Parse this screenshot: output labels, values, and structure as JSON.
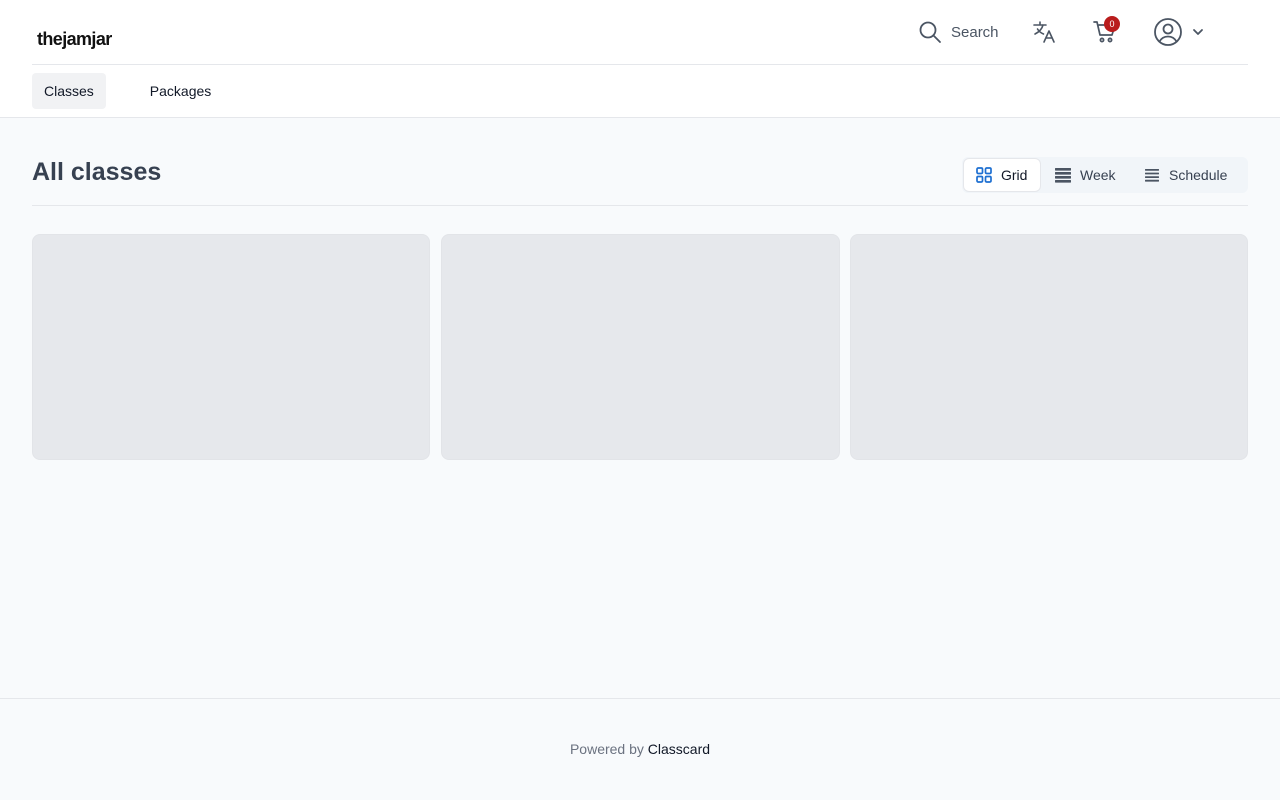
{
  "header": {
    "logo": "thejamjar",
    "search_label": "Search",
    "cart_count": "0",
    "badge_color": "#b91c1c"
  },
  "nav": {
    "tabs": [
      {
        "label": "Classes",
        "active": true
      },
      {
        "label": "Packages",
        "active": false
      }
    ]
  },
  "main": {
    "title": "All classes",
    "views": [
      {
        "label": "Grid",
        "icon": "grid-icon",
        "active": true
      },
      {
        "label": "Week",
        "icon": "week-icon",
        "active": false
      },
      {
        "label": "Schedule",
        "icon": "list-icon",
        "active": false
      }
    ],
    "loading_cards": 3
  },
  "footer": {
    "powered_prefix": "Powered by",
    "powered_brand": "Classcard"
  },
  "colors": {
    "accent": "#1d6fd1",
    "page_background": "#f8fafc",
    "skeleton": "#e6e8ec"
  }
}
